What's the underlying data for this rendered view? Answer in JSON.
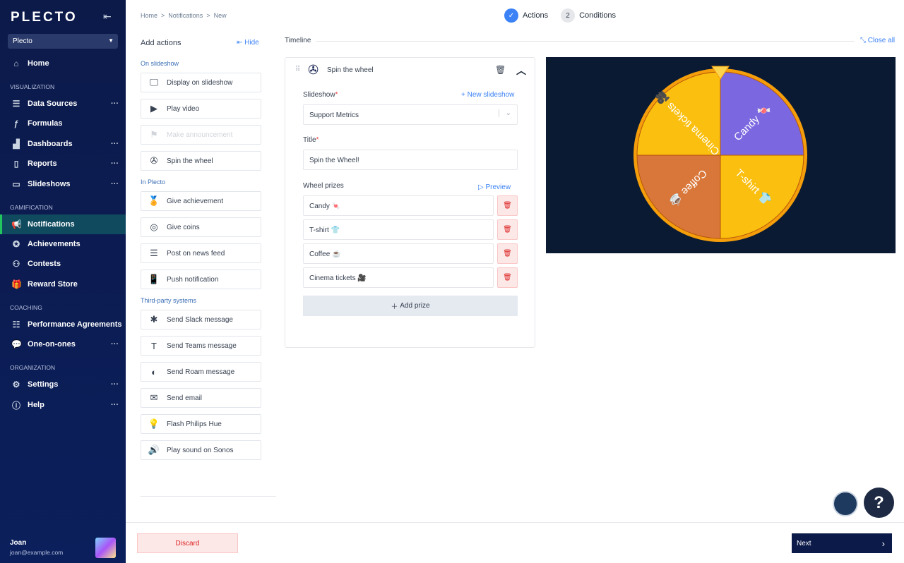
{
  "sidebar": {
    "logo": "PLECTO",
    "org": "Plecto",
    "sections": [
      "VISUALIZATION",
      "GAMIFICATION",
      "COACHING",
      "ORGANIZATION"
    ],
    "items": [
      {
        "label": "Home"
      },
      {
        "label": "Data Sources"
      },
      {
        "label": "Formulas"
      },
      {
        "label": "Dashboards"
      },
      {
        "label": "Reports"
      },
      {
        "label": "Slideshows"
      },
      {
        "label": "Notifications"
      },
      {
        "label": "Achievements"
      },
      {
        "label": "Contests"
      },
      {
        "label": "Reward Store"
      },
      {
        "label": "Performance Agreements"
      },
      {
        "label": "One-on-ones"
      },
      {
        "label": "Settings"
      },
      {
        "label": "Help"
      }
    ],
    "user": {
      "name": "Joan",
      "email": "joan@example.com"
    }
  },
  "breadcrumb": [
    "Home",
    "Notifications",
    "New"
  ],
  "steps": [
    {
      "num": "✓",
      "label": "Actions"
    },
    {
      "num": "2",
      "label": "Conditions"
    }
  ],
  "actions": {
    "title": "Add actions",
    "hide": "Hide",
    "groups": [
      "On slideshow",
      "In Plecto",
      "Third-party systems"
    ],
    "items": [
      "Display on slideshow",
      "Play video",
      "Make announcement",
      "Spin the wheel",
      "Give achievement",
      "Give coins",
      "Post on news feed",
      "Push notification",
      "Send Slack message",
      "Send Teams message",
      "Send Roam message",
      "Send email",
      "Flash Philips Hue",
      "Play sound on Sonos"
    ]
  },
  "timeline": {
    "label": "Timeline",
    "close_all": "Close all"
  },
  "card": {
    "title": "Spin the wheel",
    "slideshow_label": "Slideshow",
    "new_slideshow": "New slideshow",
    "slideshow_value": "Support Metrics",
    "title_label": "Title",
    "title_value": "Spin the Wheel!",
    "prizes_label": "Wheel prizes",
    "preview": "Preview",
    "prizes": [
      "Candy 🍬",
      "T-shirt 👕",
      "Coffee ☕",
      "Cinema tickets 🎥"
    ],
    "add_prize": "Add prize"
  },
  "wheel": {
    "segments": [
      {
        "label": "Candy 🍬",
        "color": "#7b68e0"
      },
      {
        "label": "T-shirt 👕",
        "color": "#fbbf0f"
      },
      {
        "label": "Coffee ☕",
        "color": "#d9773a"
      },
      {
        "label": "Cinema tickets 🎥",
        "color": "#fbbf0f"
      }
    ]
  },
  "footer": {
    "discard": "Discard",
    "next": "Next"
  },
  "help": "?"
}
